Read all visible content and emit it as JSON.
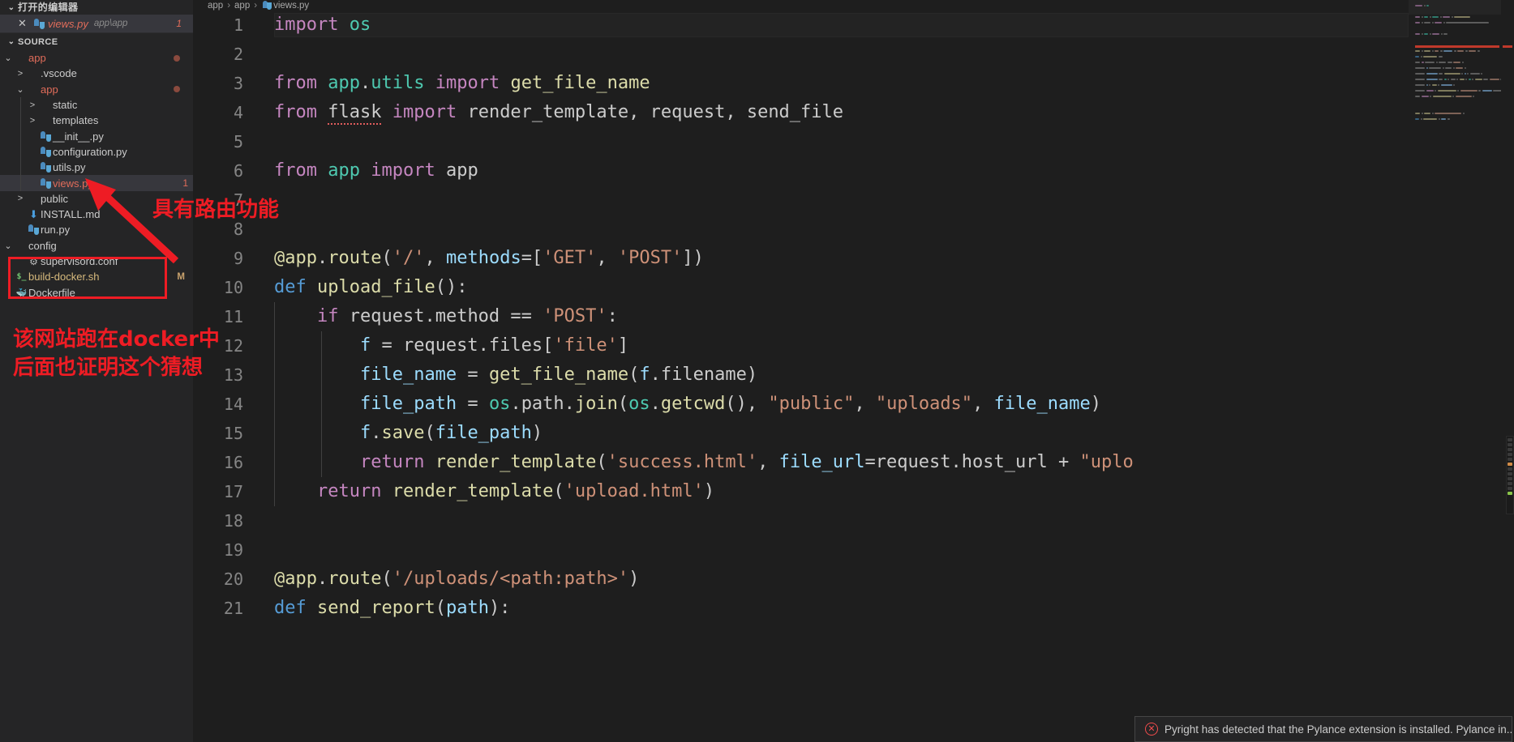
{
  "window": {
    "app": "vscode-editor"
  },
  "sidebar": {
    "open_editors": {
      "header": "打开的编辑器",
      "chevron": "⌄",
      "items": [
        {
          "close": "✕",
          "icon": "python-file-icon",
          "name": "views.py",
          "path": "app\\app",
          "badge": "1"
        }
      ]
    },
    "explorer": {
      "header": "SOURCE",
      "chevron": "⌄",
      "tree": [
        {
          "depth": 1,
          "twisty": "⌄",
          "icon": "folder-icon",
          "label": "app",
          "color": "orange",
          "dot": true,
          "badge": ""
        },
        {
          "depth": 2,
          "twisty": ">",
          "icon": "folder-icon",
          "label": ".vscode",
          "color": "white",
          "dot": false,
          "badge": ""
        },
        {
          "depth": 2,
          "twisty": "⌄",
          "icon": "folder-icon",
          "label": "app",
          "color": "orange",
          "dot": true,
          "badge": ""
        },
        {
          "depth": 3,
          "twisty": ">",
          "icon": "folder-icon",
          "label": "static",
          "color": "white",
          "dot": false,
          "badge": ""
        },
        {
          "depth": 3,
          "twisty": ">",
          "icon": "folder-icon",
          "label": "templates",
          "color": "white",
          "dot": false,
          "badge": ""
        },
        {
          "depth": 3,
          "twisty": "",
          "icon": "python-file-icon",
          "label": "__init__.py",
          "color": "white",
          "dot": false,
          "badge": ""
        },
        {
          "depth": 3,
          "twisty": "",
          "icon": "python-file-icon",
          "label": "configuration.py",
          "color": "white",
          "dot": false,
          "badge": ""
        },
        {
          "depth": 3,
          "twisty": "",
          "icon": "python-file-icon",
          "label": "utils.py",
          "color": "white",
          "dot": false,
          "badge": ""
        },
        {
          "depth": 3,
          "twisty": "",
          "icon": "python-file-icon",
          "label": "views.py",
          "color": "orange",
          "dot": false,
          "badge": "1",
          "selected": true
        },
        {
          "depth": 2,
          "twisty": ">",
          "icon": "folder-icon",
          "label": "public",
          "color": "white",
          "dot": false,
          "badge": ""
        },
        {
          "depth": 2,
          "twisty": "",
          "icon": "markdown-icon",
          "label": "INSTALL.md",
          "color": "white",
          "dot": false,
          "badge": ""
        },
        {
          "depth": 2,
          "twisty": "",
          "icon": "python-file-icon",
          "label": "run.py",
          "color": "white",
          "dot": false,
          "badge": ""
        },
        {
          "depth": 1,
          "twisty": "⌄",
          "icon": "folder-icon",
          "label": "config",
          "color": "white",
          "dot": false,
          "badge": ""
        },
        {
          "depth": 2,
          "twisty": "",
          "icon": "gear-icon",
          "label": "supervisord.conf",
          "color": "white",
          "dot": false,
          "badge": ""
        },
        {
          "depth": 1,
          "twisty": "",
          "icon": "shell-icon",
          "label": "build-docker.sh",
          "color": "yellowish",
          "dot": false,
          "badge": "M"
        },
        {
          "depth": 1,
          "twisty": "",
          "icon": "docker-icon",
          "label": "Dockerfile",
          "color": "white",
          "dot": false,
          "badge": ""
        }
      ]
    }
  },
  "breadcrumb": {
    "parts": [
      "app",
      "app",
      "views.py"
    ],
    "separator": "›",
    "file_icon": "python-file-icon"
  },
  "editor": {
    "filename": "views.py",
    "language": "python",
    "first_line": 1,
    "lines": [
      {
        "n": "1",
        "tokens": [
          {
            "t": "import",
            "c": "k"
          },
          {
            "t": " ",
            "c": "p"
          },
          {
            "t": "os",
            "c": "m"
          }
        ],
        "current": true
      },
      {
        "n": "2",
        "tokens": []
      },
      {
        "n": "3",
        "tokens": [
          {
            "t": "from",
            "c": "k"
          },
          {
            "t": " ",
            "c": "p"
          },
          {
            "t": "app",
            "c": "m"
          },
          {
            "t": ".",
            "c": "p"
          },
          {
            "t": "utils",
            "c": "m"
          },
          {
            "t": " ",
            "c": "p"
          },
          {
            "t": "import",
            "c": "k"
          },
          {
            "t": " ",
            "c": "p"
          },
          {
            "t": "get_file_name",
            "c": "f"
          }
        ]
      },
      {
        "n": "4",
        "tokens": [
          {
            "t": "from",
            "c": "k"
          },
          {
            "t": " ",
            "c": "p"
          },
          {
            "t": "flask",
            "c": "p squig"
          },
          {
            "t": " ",
            "c": "p"
          },
          {
            "t": "import",
            "c": "k"
          },
          {
            "t": " ",
            "c": "p"
          },
          {
            "t": "render_template, request, send_file",
            "c": "p"
          }
        ]
      },
      {
        "n": "5",
        "tokens": []
      },
      {
        "n": "6",
        "tokens": [
          {
            "t": "from",
            "c": "k"
          },
          {
            "t": " ",
            "c": "p"
          },
          {
            "t": "app",
            "c": "m"
          },
          {
            "t": " ",
            "c": "p"
          },
          {
            "t": "import",
            "c": "k"
          },
          {
            "t": " ",
            "c": "p"
          },
          {
            "t": "app",
            "c": "p"
          }
        ]
      },
      {
        "n": "7",
        "tokens": []
      },
      {
        "n": "8",
        "tokens": []
      },
      {
        "n": "9",
        "tokens": [
          {
            "t": "@app",
            "c": "f"
          },
          {
            "t": ".",
            "c": "p"
          },
          {
            "t": "route",
            "c": "f"
          },
          {
            "t": "(",
            "c": "p"
          },
          {
            "t": "'/'",
            "c": "s"
          },
          {
            "t": ", ",
            "c": "p"
          },
          {
            "t": "methods",
            "c": "v"
          },
          {
            "t": "=[",
            "c": "p"
          },
          {
            "t": "'GET'",
            "c": "s"
          },
          {
            "t": ", ",
            "c": "p"
          },
          {
            "t": "'POST'",
            "c": "s"
          },
          {
            "t": "])",
            "c": "p"
          }
        ]
      },
      {
        "n": "10",
        "tokens": [
          {
            "t": "def",
            "c": "kd"
          },
          {
            "t": " ",
            "c": "p"
          },
          {
            "t": "upload_file",
            "c": "f"
          },
          {
            "t": "():",
            "c": "p"
          }
        ]
      },
      {
        "n": "11",
        "tokens": [
          {
            "t": "    ",
            "c": "p"
          },
          {
            "t": "if",
            "c": "k"
          },
          {
            "t": " request",
            "c": "p"
          },
          {
            "t": ".",
            "c": "p"
          },
          {
            "t": "method",
            "c": "p"
          },
          {
            "t": " == ",
            "c": "p"
          },
          {
            "t": "'POST'",
            "c": "s"
          },
          {
            "t": ":",
            "c": "p"
          }
        ],
        "guides": 1
      },
      {
        "n": "12",
        "tokens": [
          {
            "t": "        ",
            "c": "p"
          },
          {
            "t": "f",
            "c": "v"
          },
          {
            "t": " = request",
            "c": "p"
          },
          {
            "t": ".",
            "c": "p"
          },
          {
            "t": "files",
            "c": "p"
          },
          {
            "t": "[",
            "c": "p"
          },
          {
            "t": "'file'",
            "c": "s"
          },
          {
            "t": "]",
            "c": "p"
          }
        ],
        "guides": 2
      },
      {
        "n": "13",
        "tokens": [
          {
            "t": "        ",
            "c": "p"
          },
          {
            "t": "file_name",
            "c": "v"
          },
          {
            "t": " = ",
            "c": "p"
          },
          {
            "t": "get_file_name",
            "c": "f"
          },
          {
            "t": "(",
            "c": "p"
          },
          {
            "t": "f",
            "c": "v"
          },
          {
            "t": ".",
            "c": "p"
          },
          {
            "t": "filename",
            "c": "p"
          },
          {
            "t": ")",
            "c": "p"
          }
        ],
        "guides": 2
      },
      {
        "n": "14",
        "tokens": [
          {
            "t": "        ",
            "c": "p"
          },
          {
            "t": "file_path",
            "c": "v"
          },
          {
            "t": " = ",
            "c": "p"
          },
          {
            "t": "os",
            "c": "m"
          },
          {
            "t": ".",
            "c": "p"
          },
          {
            "t": "path",
            "c": "p"
          },
          {
            "t": ".",
            "c": "p"
          },
          {
            "t": "join",
            "c": "f"
          },
          {
            "t": "(",
            "c": "p"
          },
          {
            "t": "os",
            "c": "m"
          },
          {
            "t": ".",
            "c": "p"
          },
          {
            "t": "getcwd",
            "c": "f"
          },
          {
            "t": "(), ",
            "c": "p"
          },
          {
            "t": "\"public\"",
            "c": "s"
          },
          {
            "t": ", ",
            "c": "p"
          },
          {
            "t": "\"uploads\"",
            "c": "s"
          },
          {
            "t": ", ",
            "c": "p"
          },
          {
            "t": "file_name",
            "c": "v"
          },
          {
            "t": ")",
            "c": "p"
          }
        ],
        "guides": 2
      },
      {
        "n": "15",
        "tokens": [
          {
            "t": "        ",
            "c": "p"
          },
          {
            "t": "f",
            "c": "v"
          },
          {
            "t": ".",
            "c": "p"
          },
          {
            "t": "save",
            "c": "f"
          },
          {
            "t": "(",
            "c": "p"
          },
          {
            "t": "file_path",
            "c": "v"
          },
          {
            "t": ")",
            "c": "p"
          }
        ],
        "guides": 2
      },
      {
        "n": "16",
        "tokens": [
          {
            "t": "        ",
            "c": "p"
          },
          {
            "t": "return",
            "c": "k"
          },
          {
            "t": " ",
            "c": "p"
          },
          {
            "t": "render_template",
            "c": "f"
          },
          {
            "t": "(",
            "c": "p"
          },
          {
            "t": "'success.html'",
            "c": "s"
          },
          {
            "t": ", ",
            "c": "p"
          },
          {
            "t": "file_url",
            "c": "v"
          },
          {
            "t": "=request",
            "c": "p"
          },
          {
            "t": ".",
            "c": "p"
          },
          {
            "t": "host_url",
            "c": "p"
          },
          {
            "t": " + ",
            "c": "p"
          },
          {
            "t": "\"uplo",
            "c": "s"
          }
        ],
        "guides": 2
      },
      {
        "n": "17",
        "tokens": [
          {
            "t": "    ",
            "c": "p"
          },
          {
            "t": "return",
            "c": "k"
          },
          {
            "t": " ",
            "c": "p"
          },
          {
            "t": "render_template",
            "c": "f"
          },
          {
            "t": "(",
            "c": "p"
          },
          {
            "t": "'upload.html'",
            "c": "s"
          },
          {
            "t": ")",
            "c": "p"
          }
        ],
        "guides": 1
      },
      {
        "n": "18",
        "tokens": []
      },
      {
        "n": "19",
        "tokens": []
      },
      {
        "n": "20",
        "tokens": [
          {
            "t": "@app",
            "c": "f"
          },
          {
            "t": ".",
            "c": "p"
          },
          {
            "t": "route",
            "c": "f"
          },
          {
            "t": "(",
            "c": "p"
          },
          {
            "t": "'/uploads/<path:path>'",
            "c": "s"
          },
          {
            "t": ")",
            "c": "p"
          }
        ]
      },
      {
        "n": "21",
        "tokens": [
          {
            "t": "def",
            "c": "kd"
          },
          {
            "t": " ",
            "c": "p"
          },
          {
            "t": "send_report",
            "c": "f"
          },
          {
            "t": "(",
            "c": "p"
          },
          {
            "t": "path",
            "c": "v"
          },
          {
            "t": "):",
            "c": "p"
          }
        ]
      }
    ]
  },
  "toast": {
    "icon": "error-circle-icon",
    "message": "Pyright has detected that the Pylance extension is installed. Pylance in..."
  },
  "annotations": {
    "arrow_label": "具有路由功能",
    "docker_line1": "该网站跑在docker中",
    "docker_line2": "后面也证明这个猜想",
    "color": "#ee1c24",
    "rect_target": "build-docker.sh / Dockerfile",
    "arrow_target": "views.py"
  },
  "colors": {
    "sidebar_bg": "#252526",
    "editor_bg": "#1e1e1e",
    "selection": "#37373d",
    "accent_orange": "#e06c5a",
    "annotation_red": "#ee1c24",
    "error_red": "#f14c4c"
  }
}
